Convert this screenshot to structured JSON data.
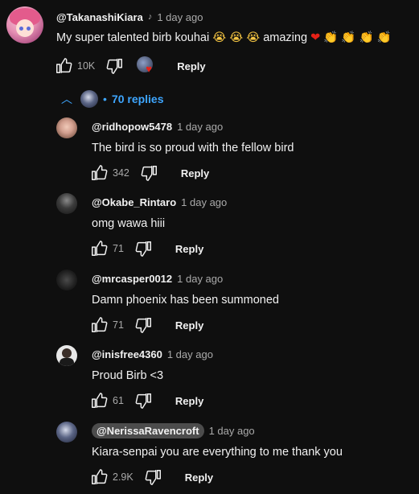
{
  "top_comment": {
    "handle": "@TakanashiKiara",
    "time": "1 day ago",
    "text": "My super talented birb kouhai",
    "text_after": "amazing",
    "like_count": "10K",
    "reply_label": "Reply"
  },
  "replies_toggle": {
    "label": "70 replies"
  },
  "replies": [
    {
      "handle": "@ridhopow5478",
      "time": "1 day ago",
      "text": "The bird is so proud with the fellow bird",
      "likes": "342",
      "reply_label": "Reply"
    },
    {
      "handle": "@Okabe_Rintaro",
      "time": "1 day ago",
      "text": "omg wawa hiii",
      "likes": "71",
      "reply_label": "Reply"
    },
    {
      "handle": "@mrcasper0012",
      "time": "1 day ago",
      "text": "Damn phoenix has been summoned",
      "likes": "71",
      "reply_label": "Reply"
    },
    {
      "handle": "@inisfree4360",
      "time": "1 day ago",
      "text": "Proud Birb <3",
      "likes": "61",
      "reply_label": "Reply"
    },
    {
      "handle": "@NerissaRavencroft",
      "time": "1 day ago",
      "text": "Kiara-senpai you are everything to me thank you",
      "likes": "2.9K",
      "reply_label": "Reply"
    }
  ],
  "colors": {
    "background": "#0f0f0f",
    "link_blue": "#3ea6ff",
    "muted_text": "#aaaaaa",
    "heart_red": "#e62117"
  }
}
